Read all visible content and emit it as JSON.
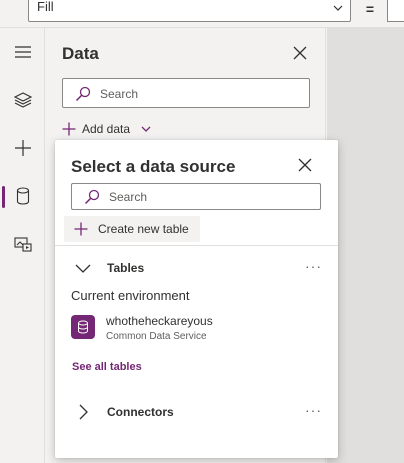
{
  "formula_bar": {
    "property_value": "Fill",
    "equals_label": "="
  },
  "rail": {
    "items": [
      {
        "name": "menu"
      },
      {
        "name": "layers"
      },
      {
        "name": "insert"
      },
      {
        "name": "data",
        "active": true
      },
      {
        "name": "media"
      }
    ]
  },
  "data_panel": {
    "title": "Data",
    "search_placeholder": "Search",
    "add_data_label": "Add data"
  },
  "flyout": {
    "title": "Select a data source",
    "search_placeholder": "Search",
    "create_table_label": "Create new table",
    "tables_label": "Tables",
    "environment_label": "Current environment",
    "environment_item": {
      "name": "whotheheckareyous",
      "subtitle": "Common Data Service"
    },
    "see_all_label": "See all tables",
    "connectors_label": "Connectors",
    "more_label": "···"
  },
  "colors": {
    "accent": "#742774",
    "panel_bg": "#f3f2f1",
    "canvas_bg": "#e1dfdd"
  }
}
